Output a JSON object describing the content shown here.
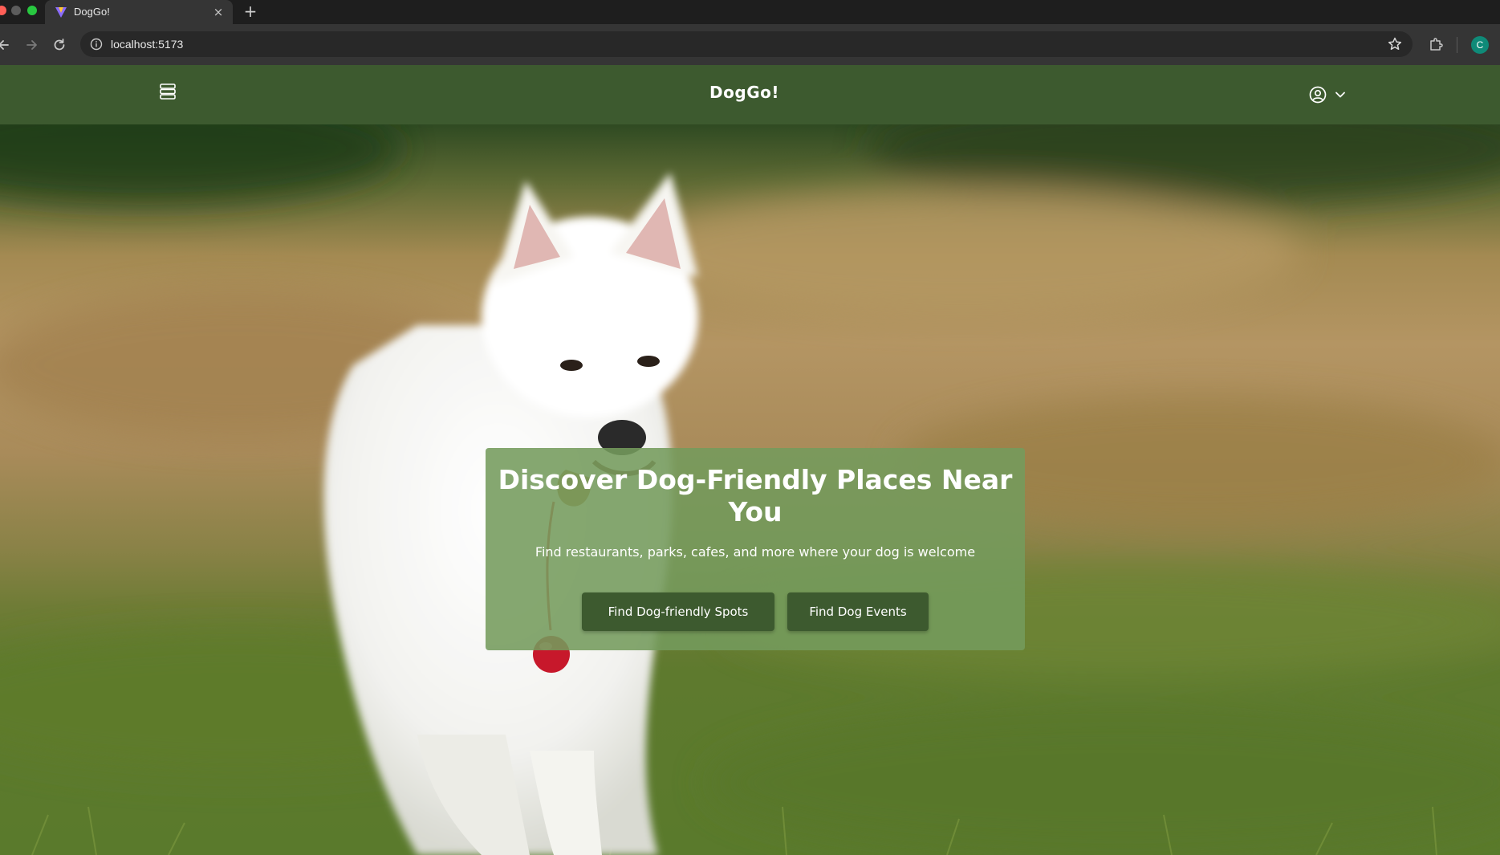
{
  "browser": {
    "tab_title": "DogGo!",
    "tab_close_glyph": "×",
    "new_tab_glyph": "+",
    "url": "localhost:5173",
    "profile_initial": "C"
  },
  "header": {
    "brand": "DogGo!",
    "menu_icon": "menu-icon",
    "user_icon": "user-circle-icon",
    "chevron_icon": "chevron-down-icon"
  },
  "hero": {
    "title": "Discover Dog-Friendly Places Near You",
    "subtitle": "Find restaurants, parks, cafes, and more where your dog is welcome",
    "buttons": {
      "spots": "Find Dog-friendly Spots",
      "events": "Find Dog Events"
    }
  },
  "colors": {
    "header_bg": "#3d5a2f",
    "button_bg": "#3d5a2f",
    "card_bg": "#749b5c",
    "profile_avatar": "#0f8a78"
  }
}
